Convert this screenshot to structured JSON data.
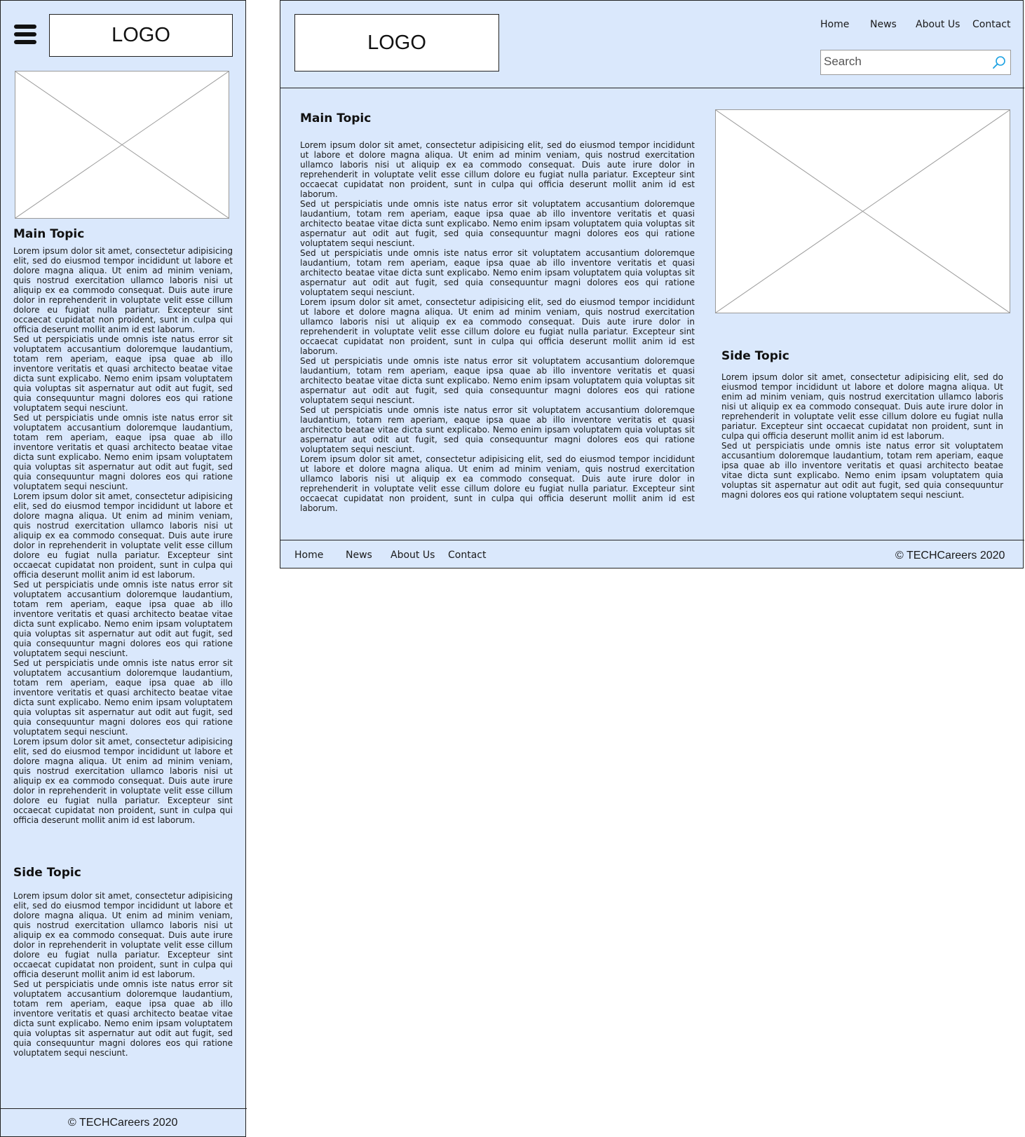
{
  "mobile": {
    "logo_text": "LOGO",
    "main_topic_title": "Main Topic",
    "main_paragraphs": [
      "Lorem ipsum dolor sit amet, consectetur adipisicing elit, sed do eiusmod tempor incididunt ut labore et dolore magna aliqua. Ut enim ad minim veniam, quis nostrud exercitation ullamco laboris nisi ut aliquip ex ea commodo consequat. Duis aute irure dolor in reprehenderit in voluptate velit esse cillum dolore eu fugiat nulla pariatur. Excepteur sint occaecat cupidatat non proident, sunt in culpa qui officia deserunt mollit anim id est laborum.",
      "Sed ut perspiciatis unde omnis iste natus error sit voluptatem accusantium doloremque laudantium, totam rem aperiam, eaque ipsa quae ab illo inventore veritatis et quasi architecto beatae vitae dicta sunt explicabo. Nemo enim ipsam voluptatem quia voluptas sit aspernatur aut odit aut fugit, sed quia consequuntur magni dolores eos qui ratione voluptatem sequi nesciunt.",
      "Sed ut perspiciatis unde omnis iste natus error sit voluptatem accusantium doloremque laudantium, totam rem aperiam, eaque ipsa quae ab illo inventore veritatis et quasi architecto beatae vitae dicta sunt explicabo. Nemo enim ipsam voluptatem quia voluptas sit aspernatur aut odit aut fugit, sed quia consequuntur magni dolores eos qui ratione voluptatem sequi nesciunt.",
      "Lorem ipsum dolor sit amet, consectetur adipisicing elit, sed do eiusmod tempor incididunt ut labore et dolore magna aliqua. Ut enim ad minim veniam, quis nostrud exercitation ullamco laboris nisi ut aliquip ex ea commodo consequat. Duis aute irure dolor in reprehenderit in voluptate velit esse cillum dolore eu fugiat nulla pariatur. Excepteur sint occaecat cupidatat non proident, sunt in culpa qui officia deserunt mollit anim id est laborum.",
      "Sed ut perspiciatis unde omnis iste natus error sit voluptatem accusantium doloremque laudantium, totam rem aperiam, eaque ipsa quae ab illo inventore veritatis et quasi architecto beatae vitae dicta sunt explicabo. Nemo enim ipsam voluptatem quia voluptas sit aspernatur aut odit aut fugit, sed quia consequuntur magni dolores eos qui ratione voluptatem sequi nesciunt.",
      "Sed ut perspiciatis unde omnis iste natus error sit voluptatem accusantium doloremque laudantium, totam rem aperiam, eaque ipsa quae ab illo inventore veritatis et quasi architecto beatae vitae dicta sunt explicabo. Nemo enim ipsam voluptatem quia voluptas sit aspernatur aut odit aut fugit, sed quia consequuntur magni dolores eos qui ratione voluptatem sequi nesciunt.",
      "Lorem ipsum dolor sit amet, consectetur adipisicing elit, sed do eiusmod tempor incididunt ut labore et dolore magna aliqua. Ut enim ad minim veniam, quis nostrud exercitation ullamco laboris nisi ut aliquip ex ea commodo consequat. Duis aute irure dolor in reprehenderit in voluptate velit esse cillum dolore eu fugiat nulla pariatur. Excepteur sint occaecat cupidatat non proident, sunt in culpa qui officia deserunt mollit anim id est laborum."
    ],
    "side_topic_title": "Side Topic",
    "side_paragraphs": [
      "Lorem ipsum dolor sit amet, consectetur adipisicing elit, sed do eiusmod tempor incididunt ut labore et dolore magna aliqua. Ut enim ad minim veniam, quis nostrud exercitation ullamco laboris nisi ut aliquip ex ea commodo consequat. Duis aute irure dolor in reprehenderit in voluptate velit esse cillum dolore eu fugiat nulla pariatur. Excepteur sint occaecat cupidatat non proident, sunt in culpa qui officia deserunt mollit anim id est laborum.",
      "Sed ut perspiciatis unde omnis iste natus error sit voluptatem accusantium doloremque laudantium, totam rem aperiam, eaque ipsa quae ab illo inventore veritatis et quasi architecto beatae vitae dicta sunt explicabo. Nemo enim ipsam voluptatem quia voluptas sit aspernatur aut odit aut fugit, sed quia consequuntur magni dolores eos qui ratione voluptatem sequi nesciunt."
    ],
    "copyright": "© TECHCareers 2020"
  },
  "desktop": {
    "logo_text": "LOGO",
    "nav": {
      "home": "Home",
      "news": "News",
      "about": "About Us",
      "contact": "Contact"
    },
    "search_placeholder": "Search",
    "main_topic_title": "Main Topic",
    "main_paragraphs": [
      "Lorem ipsum dolor sit amet, consectetur adipisicing elit, sed do eiusmod tempor incididunt ut labore et dolore magna aliqua. Ut enim ad minim veniam, quis nostrud exercitation ullamco laboris nisi ut aliquip ex ea commodo consequat. Duis aute irure dolor in reprehenderit in voluptate velit esse cillum dolore eu fugiat nulla pariatur. Excepteur sint occaecat cupidatat non proident, sunt in culpa qui officia deserunt mollit anim id est laborum.",
      "Sed ut perspiciatis unde omnis iste natus error sit voluptatem accusantium doloremque laudantium, totam rem aperiam, eaque ipsa quae ab illo inventore veritatis et quasi architecto beatae vitae dicta sunt explicabo. Nemo enim ipsam voluptatem quia voluptas sit aspernatur aut odit aut fugit, sed quia consequuntur magni dolores eos qui ratione voluptatem sequi nesciunt.",
      "Sed ut perspiciatis unde omnis iste natus error sit voluptatem accusantium doloremque laudantium, totam rem aperiam, eaque ipsa quae ab illo inventore veritatis et quasi architecto beatae vitae dicta sunt explicabo. Nemo enim ipsam voluptatem quia voluptas sit aspernatur aut odit aut fugit, sed quia consequuntur magni dolores eos qui ratione voluptatem sequi nesciunt.",
      "Lorem ipsum dolor sit amet, consectetur adipisicing elit, sed do eiusmod tempor incididunt ut labore et dolore magna aliqua. Ut enim ad minim veniam, quis nostrud exercitation ullamco laboris nisi ut aliquip ex ea commodo consequat. Duis aute irure dolor in reprehenderit in voluptate velit esse cillum dolore eu fugiat nulla pariatur. Excepteur sint occaecat cupidatat non proident, sunt in culpa qui officia deserunt mollit anim id est laborum.",
      "Sed ut perspiciatis unde omnis iste natus error sit voluptatem accusantium doloremque laudantium, totam rem aperiam, eaque ipsa quae ab illo inventore veritatis et quasi architecto beatae vitae dicta sunt explicabo. Nemo enim ipsam voluptatem quia voluptas sit aspernatur aut odit aut fugit, sed quia consequuntur magni dolores eos qui ratione voluptatem sequi nesciunt.",
      "Sed ut perspiciatis unde omnis iste natus error sit voluptatem accusantium doloremque laudantium, totam rem aperiam, eaque ipsa quae ab illo inventore veritatis et quasi architecto beatae vitae dicta sunt explicabo. Nemo enim ipsam voluptatem quia voluptas sit aspernatur aut odit aut fugit, sed quia consequuntur magni dolores eos qui ratione voluptatem sequi nesciunt.",
      "Lorem ipsum dolor sit amet, consectetur adipisicing elit, sed do eiusmod tempor incididunt ut labore et dolore magna aliqua. Ut enim ad minim veniam, quis nostrud exercitation ullamco laboris nisi ut aliquip ex ea commodo consequat. Duis aute irure dolor in reprehenderit in voluptate velit esse cillum dolore eu fugiat nulla pariatur. Excepteur sint occaecat cupidatat non proident, sunt in culpa qui officia deserunt mollit anim id est laborum."
    ],
    "side_topic_title": "Side Topic",
    "side_paragraphs": [
      "Lorem ipsum dolor sit amet, consectetur adipisicing elit, sed do eiusmod tempor incididunt ut labore et dolore magna aliqua. Ut enim ad minim veniam, quis nostrud exercitation ullamco laboris nisi ut aliquip ex ea commodo consequat. Duis aute irure dolor in reprehenderit in voluptate velit esse cillum dolore eu fugiat nulla pariatur. Excepteur sint occaecat cupidatat non proident, sunt in culpa qui officia deserunt mollit anim id est laborum.",
      "Sed ut perspiciatis unde omnis iste natus error sit voluptatem accusantium doloremque laudantium, totam rem aperiam, eaque ipsa quae ab illo inventore veritatis et quasi architecto beatae vitae dicta sunt explicabo. Nemo enim ipsam voluptatem quia voluptas sit aspernatur aut odit aut fugit, sed quia consequuntur magni dolores eos qui ratione voluptatem sequi nesciunt."
    ],
    "footer_nav": {
      "home": "Home",
      "news": "News",
      "about": "About Us",
      "contact": "Contact"
    },
    "copyright": "© TECHCareers 2020"
  },
  "icons": {
    "menu": "hamburger-menu-icon",
    "search": "search-icon",
    "image": "image-placeholder-icon"
  },
  "colors": {
    "panel_background": "#dae8fc",
    "border": "#222222",
    "search_icon": "#1ba1e2"
  }
}
